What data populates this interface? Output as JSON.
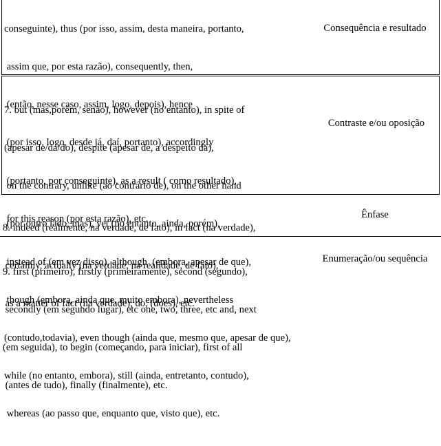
{
  "rows": [
    {
      "lines": [
        "conseguinte), thus (por isso, assim, desta maneira, portanto,",
        " assim que, por esta razão), consequently, then,",
        " (então, nesse caso, assim, logo, depois), hence",
        " (por isso, logo, desde já, daí, portanto), accordingly",
        " (portanto, por conseguinte), as a result ( como resultado),",
        " for this reason (por esta razão), etc."
      ],
      "category": "Consequência e resultado"
    },
    {
      "lines": [
        "7. but (mas,porém, senão), however (no entanto), in spite of",
        "(apesar de/da/do), despite (apesar de, a despeito da),",
        " on the contrary, unlike (ao contrário de), on the other hand",
        " (por outro lado, mas), yet (no entanto, ainda, porém),",
        " instead of (em vez disso), although  (embora, apesar de que),",
        " though (embora, ainda que, muito embora), nevertheless",
        "(contudo,todavia), even though (ainda que, mesmo que, apesar de que),",
        "while (no entanto, embora), still (ainda, entretanto, contudo),",
        " whereas (ao passo que, enquanto que, visto que), etc."
      ],
      "category": "Contraste e/ou oposição"
    },
    {
      "lines": [
        "8. indeed (realmente, na verdade, de fato), in fact (na verdade),",
        " certainly, actually (na verdade, na realidade, de fato),",
        " as a matter of fact (na verdade), do, (does), etc."
      ],
      "category": "Ênfase"
    },
    {
      "lines": [
        "9. first (primeiro), firstly (primeiramente), second (segundo),",
        " secondly (em segundo lugar), etc one, two, three, etc and, next",
        "(em seguida), to begin (começando, para iniciar), first of all",
        " (antes de tudo), finally (finalmente), etc."
      ],
      "category": "Enumeração/ou sequência"
    }
  ]
}
